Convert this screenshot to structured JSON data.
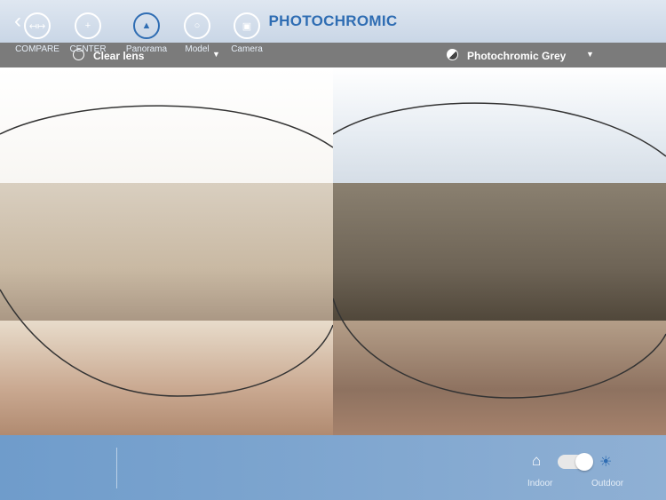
{
  "header": {
    "title": "PHOTOCHROMIC",
    "back_icon": "chevron-left-icon"
  },
  "selectors": [
    {
      "label": "Clear lens",
      "icon": "empty-circle-icon"
    },
    {
      "label": "Photochromic Grey",
      "icon": "half-filled-circle-icon"
    }
  ],
  "toolbar": {
    "items": [
      {
        "label": "COMPARE",
        "icon": "compare-icon"
      },
      {
        "label": "CENTER",
        "icon": "crosshair-icon"
      },
      {
        "label": "Panorama",
        "icon": "panorama-icon",
        "active": true
      },
      {
        "label": "Model",
        "icon": "person-icon"
      },
      {
        "label": "Camera",
        "icon": "camera-icon"
      }
    ],
    "indoor_label": "Indoor",
    "outdoor_label": "Outdoor",
    "mode": "Outdoor"
  },
  "colors": {
    "accent": "#2f6db3",
    "toolbar": "#7ea6d0"
  }
}
